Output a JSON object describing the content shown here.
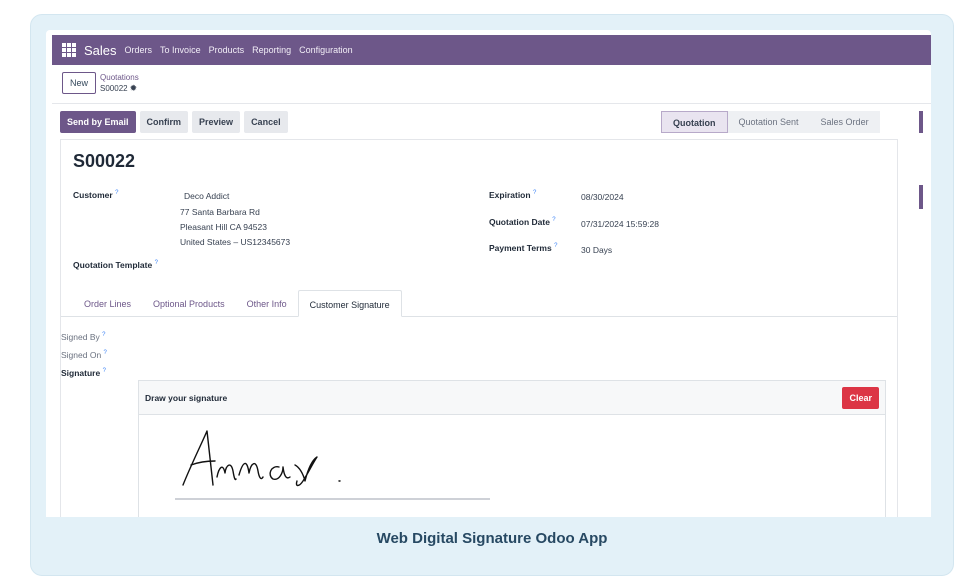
{
  "caption": "Web Digital Signature Odoo App",
  "navbar": {
    "brand": "Sales",
    "items": [
      "Orders",
      "To Invoice",
      "Products",
      "Reporting",
      "Configuration"
    ]
  },
  "breadcrumb": {
    "new_label": "New",
    "parent": "Quotations",
    "current": "S00022"
  },
  "actions": {
    "send_by_email": "Send by Email",
    "confirm": "Confirm",
    "preview": "Preview",
    "cancel": "Cancel"
  },
  "status": [
    "Quotation",
    "Quotation Sent",
    "Sales Order"
  ],
  "form": {
    "title": "S00022",
    "customer_label": "Customer",
    "customer": {
      "name": "Deco Addict",
      "address1": "77 Santa Barbara Rd",
      "address2": "Pleasant Hill CA 94523",
      "address3": "United States – US12345673"
    },
    "quotation_template_label": "Quotation Template",
    "expiration_label": "Expiration",
    "expiration": "08/30/2024",
    "quotation_date_label": "Quotation Date",
    "quotation_date": "07/31/2024 15:59:28",
    "payment_terms_label": "Payment Terms",
    "payment_terms": "30 Days",
    "help_mark": "?"
  },
  "tabs": [
    "Order Lines",
    "Optional Products",
    "Other Info",
    "Customer Signature"
  ],
  "signature": {
    "signed_by_label": "Signed By",
    "signed_on_label": "Signed On",
    "signature_label": "Signature",
    "pad_title": "Draw your signature",
    "clear_label": "Clear",
    "handwriting": "Ammar."
  },
  "colors": {
    "brand": "#6d5789",
    "danger": "#dc3545",
    "card_bg": "#e3f1f8",
    "caption": "#274963"
  }
}
